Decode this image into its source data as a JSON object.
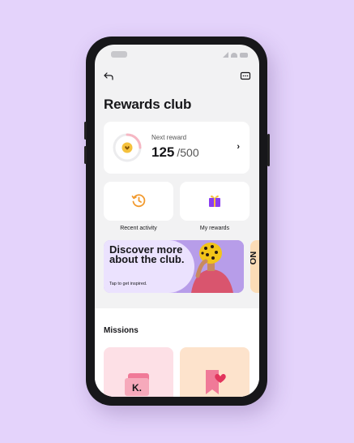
{
  "header": {
    "title": "Rewards club"
  },
  "reward": {
    "next_label": "Next reward",
    "points": "125",
    "total": "/500",
    "progress": 0.25
  },
  "tiles": [
    {
      "label": "Recent activity",
      "icon": "clock-history-icon"
    },
    {
      "label": "My rewards",
      "icon": "gift-icon"
    }
  ],
  "banner": {
    "headline": "Discover more about the club.",
    "subtext": "Tap to get inspired.",
    "peek_text": "NO"
  },
  "missions": {
    "title": "Missions",
    "card_icons": [
      "klarna-card-icon",
      "bookmark-heart-icon"
    ]
  },
  "colors": {
    "background": "#e4d3fb",
    "accent_pink": "#f6b7c3",
    "gift_purple": "#8a3cf0",
    "clock_orange": "#f29a2e"
  }
}
